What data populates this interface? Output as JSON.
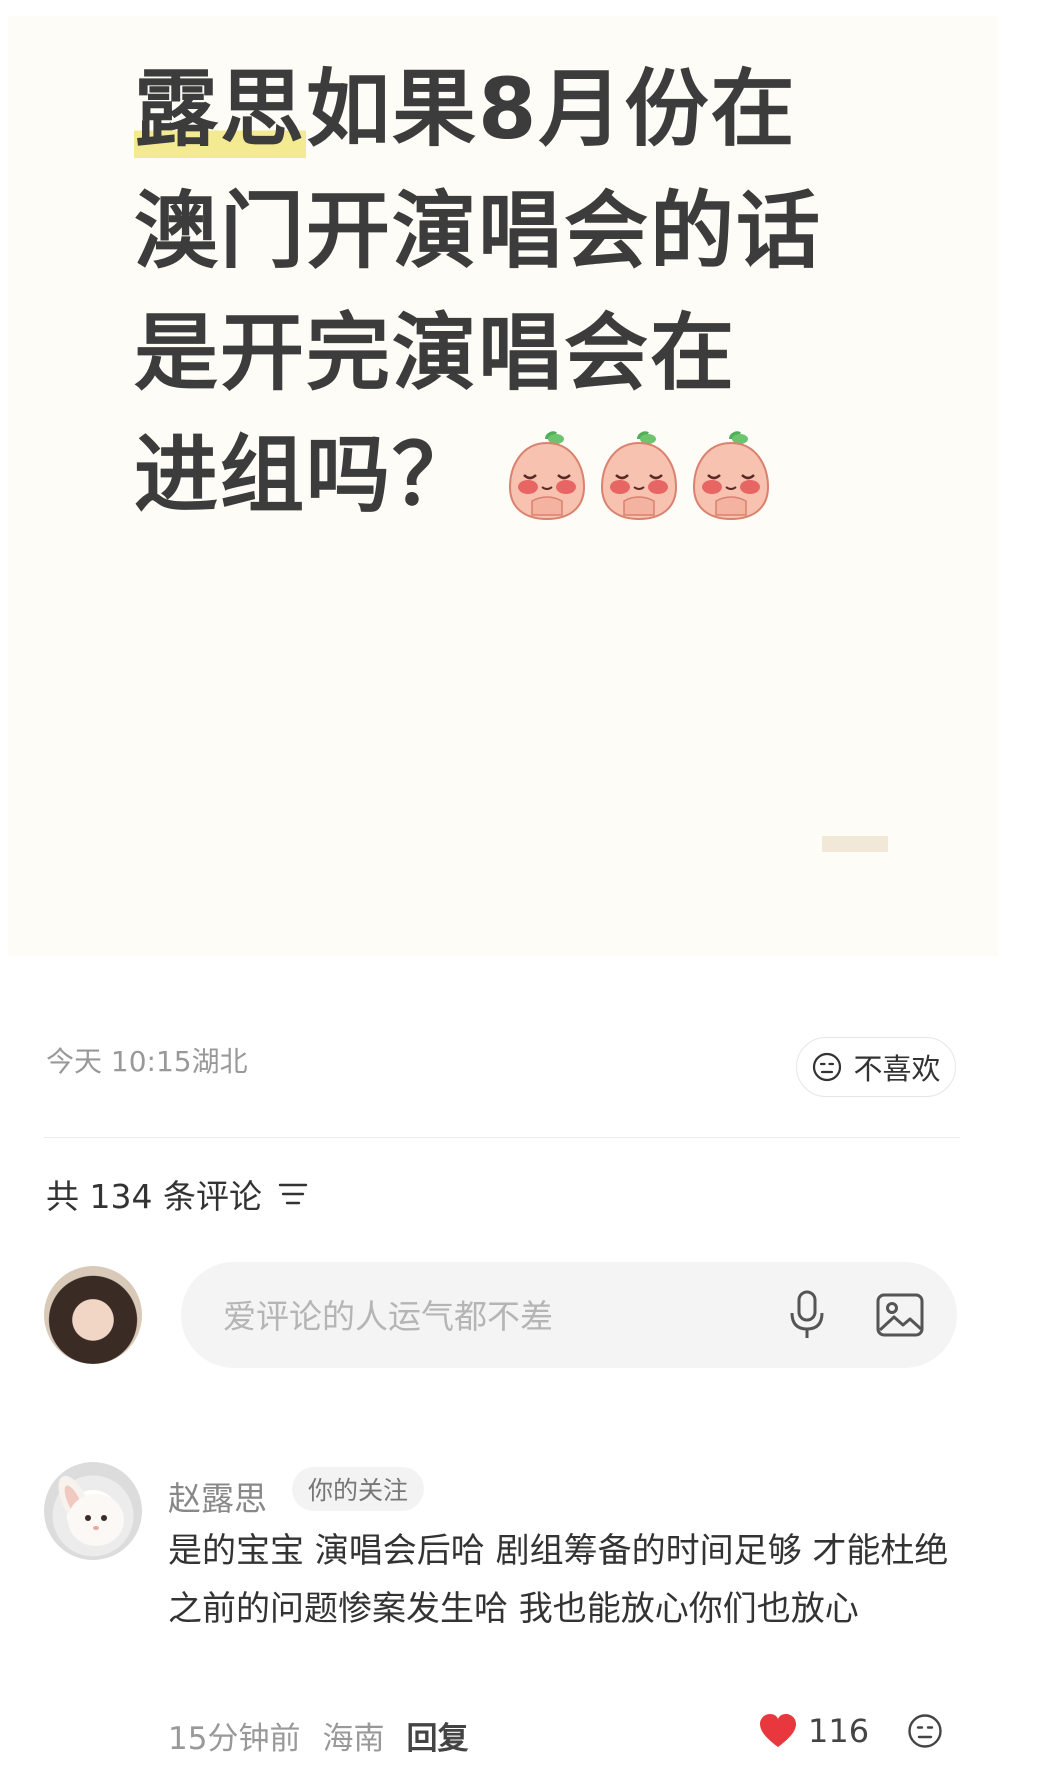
{
  "post": {
    "title_highlight": "露思",
    "title_line1_rest": "如果8月份在",
    "title_line2": "澳门开演唱会的话",
    "title_line3": "是开完演唱会在",
    "title_line4": "进组吗？",
    "emoji_icons": [
      "peach-face-icon",
      "peach-face-icon",
      "peach-face-icon"
    ]
  },
  "meta": {
    "time_location": "今天 10:15湖北",
    "dislike_label": "不喜欢"
  },
  "comments_header": {
    "count_label": "共 134 条评论"
  },
  "input": {
    "placeholder": "爱评论的人运气都不差"
  },
  "comment": {
    "author": "赵露思",
    "badge": "你的关注",
    "text": "是的宝宝 演唱会后哈 剧组筹备的时间足够 才能杜绝之前的问题惨案发生哈 我也能放心你们也放心",
    "time": "15分钟前",
    "location": "海南",
    "reply_label": "回复",
    "like_count": "116"
  },
  "colors": {
    "heart": "#e8383d",
    "highlight": "#f4ea92",
    "card_bg": "#fdfcf7"
  }
}
